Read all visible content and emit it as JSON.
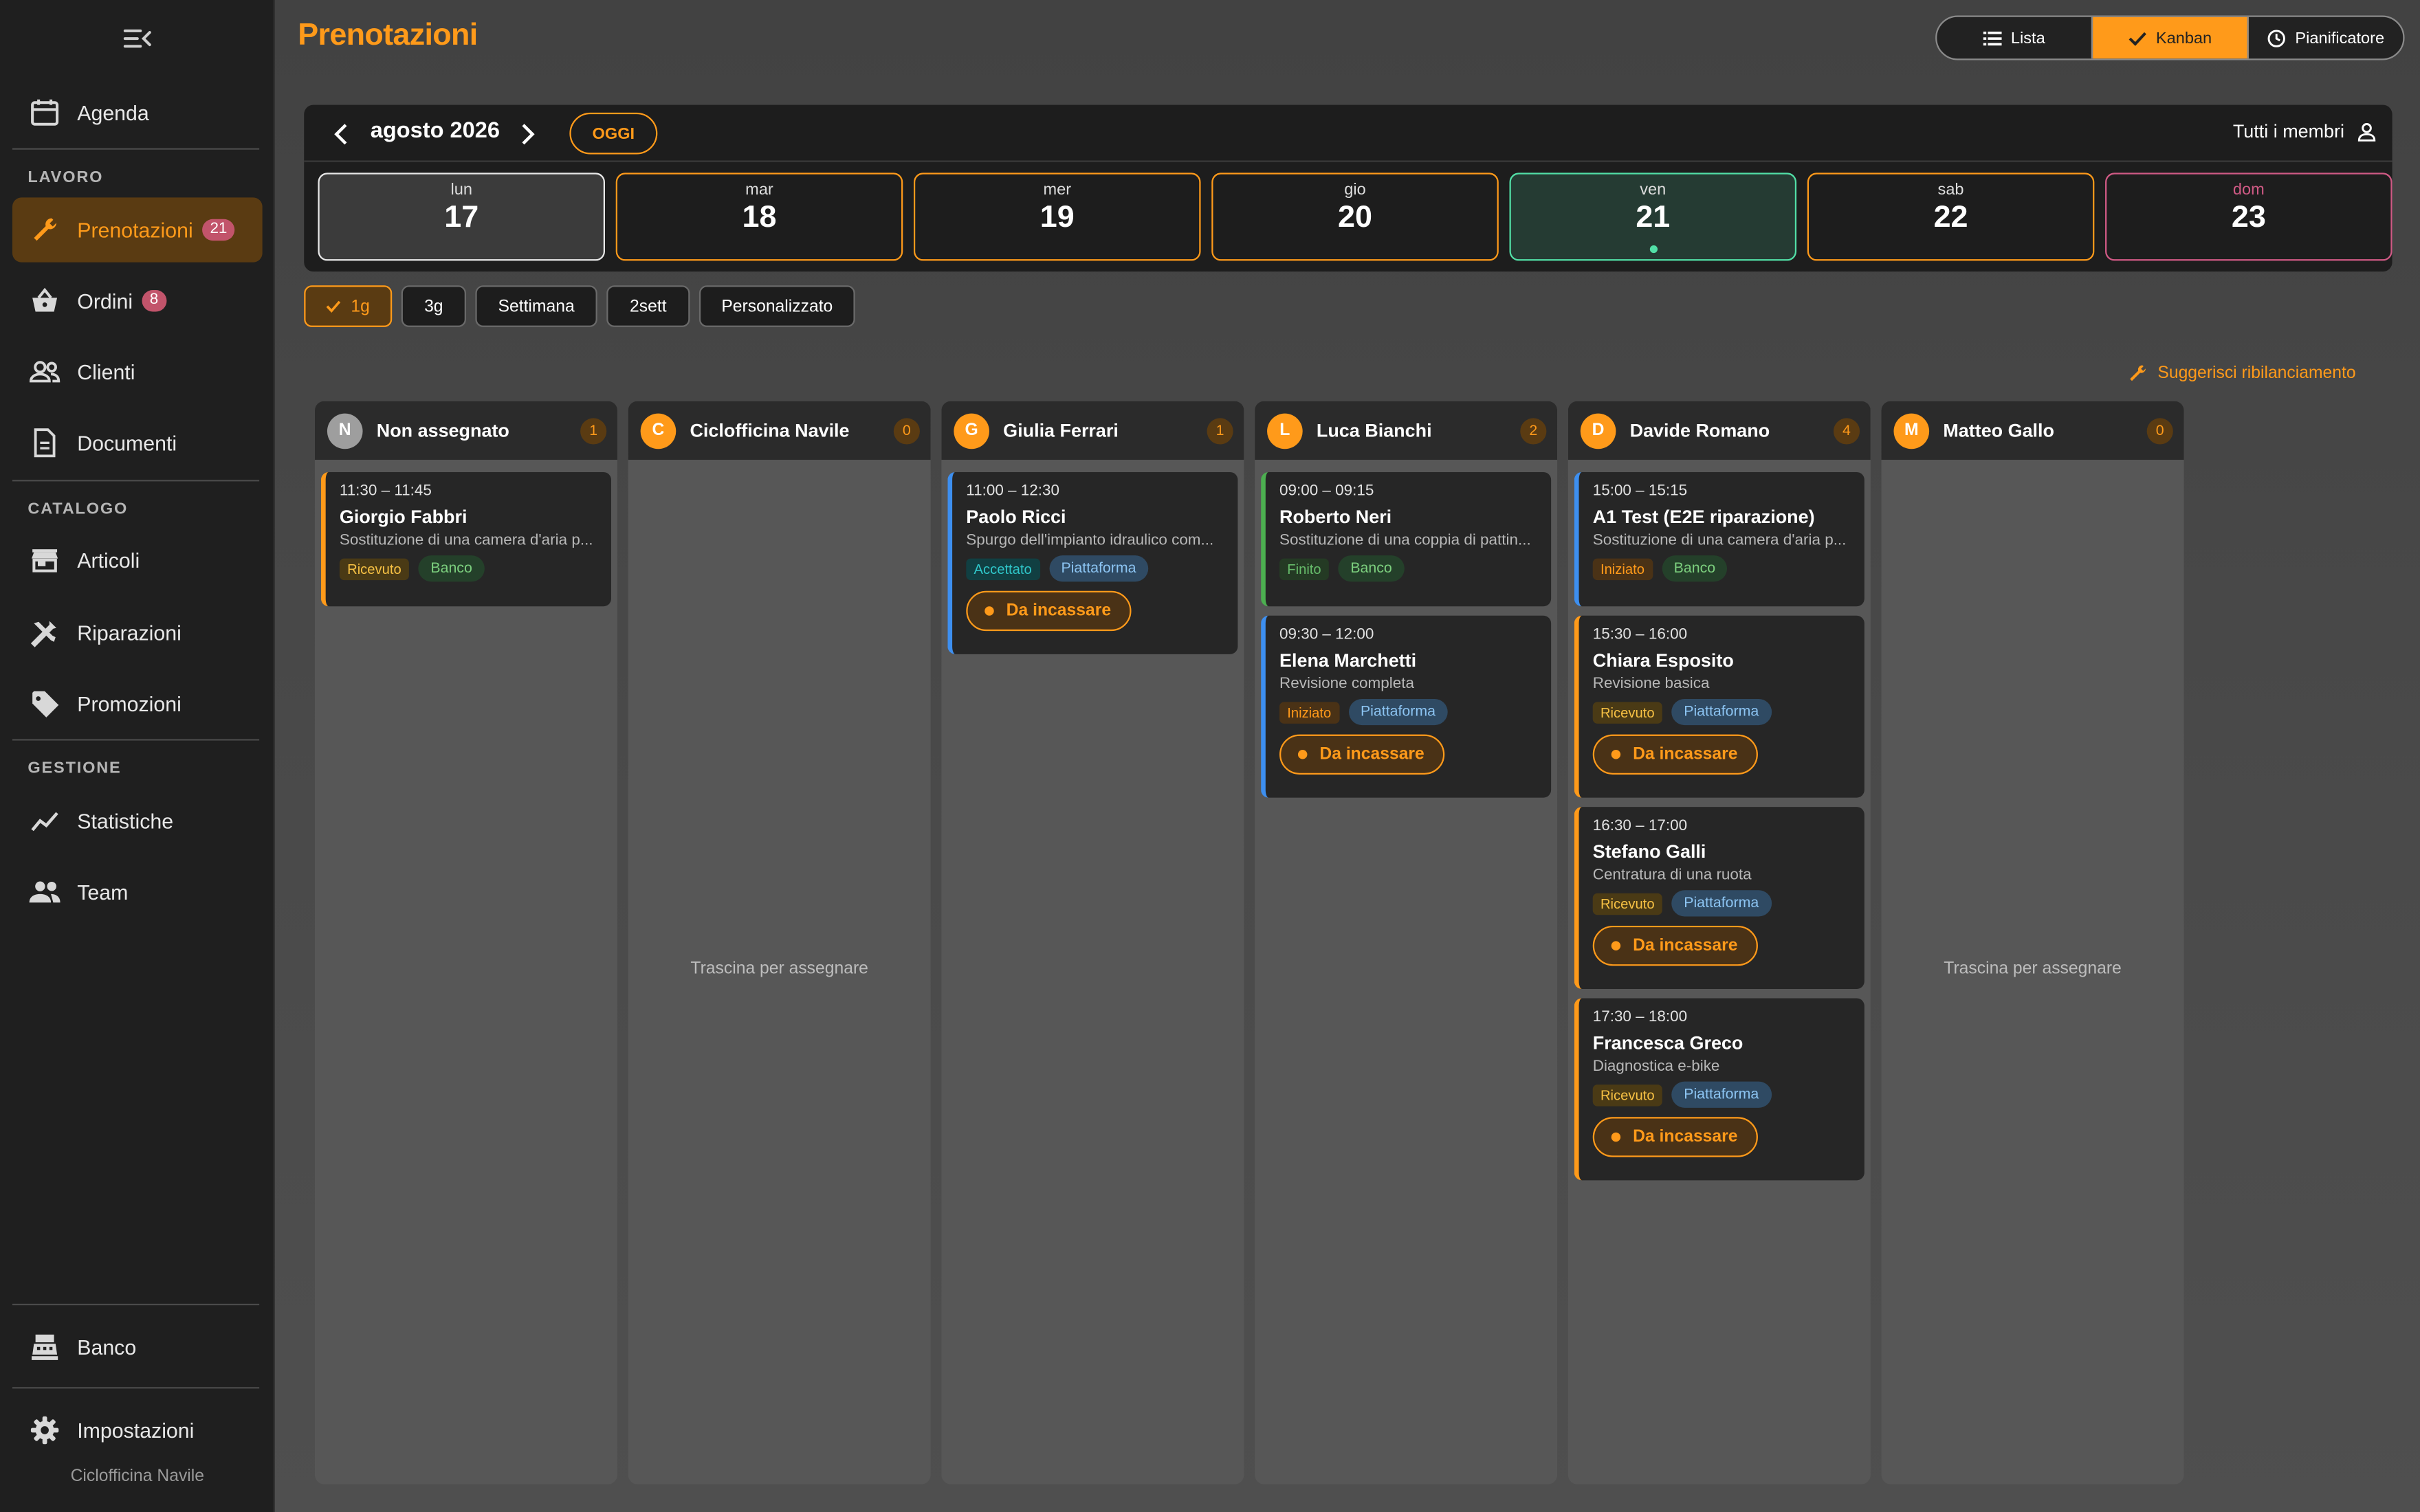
{
  "sidebar": {
    "top_item": {
      "label": "Agenda",
      "icon": "calendar-icon"
    },
    "sections": {
      "lavoro": "LAVORO",
      "catalogo": "CATALOGO",
      "gestione": "GESTIONE"
    },
    "items": {
      "prenotazioni": {
        "label": "Prenotazioni",
        "badge": "21",
        "icon": "wrench-icon"
      },
      "ordini": {
        "label": "Ordini",
        "badge": "8",
        "icon": "basket-icon"
      },
      "clienti": {
        "label": "Clienti",
        "icon": "people-icon"
      },
      "documenti": {
        "label": "Documenti",
        "icon": "document-icon"
      },
      "articoli": {
        "label": "Articoli",
        "icon": "store-icon"
      },
      "riparazioni": {
        "label": "Riparazioni",
        "icon": "tools-icon"
      },
      "promozioni": {
        "label": "Promozioni",
        "icon": "tag-icon"
      },
      "statistiche": {
        "label": "Statistiche",
        "icon": "chart-line-icon"
      },
      "team": {
        "label": "Team",
        "icon": "team-icon"
      },
      "banco": {
        "label": "Banco",
        "icon": "register-icon"
      },
      "impostazioni": {
        "label": "Impostazioni",
        "icon": "gear-icon"
      }
    },
    "shop_name": "Ciclofficina Navile"
  },
  "header": {
    "title": "Prenotazioni",
    "views": [
      "Lista",
      "Kanban",
      "Pianificatore"
    ],
    "selected_view": "Kanban"
  },
  "datebar": {
    "month": "agosto 2026",
    "today_label": "OGGI",
    "members": "Tutti i membri",
    "days": [
      {
        "name": "lun",
        "num": "17"
      },
      {
        "name": "mar",
        "num": "18"
      },
      {
        "name": "mer",
        "num": "19"
      },
      {
        "name": "gio",
        "num": "20"
      },
      {
        "name": "ven",
        "num": "21"
      },
      {
        "name": "sab",
        "num": "22"
      },
      {
        "name": "dom",
        "num": "23"
      }
    ]
  },
  "ranges": [
    "1g",
    "3g",
    "Settimana",
    "2sett",
    "Personalizzato"
  ],
  "suggest": "Suggerisci ribilanciamento",
  "drop_hint": "Trascina per assegnare",
  "colors": {
    "accent": "#ff9a1a",
    "today": "#52e0a7",
    "sunday": "#d05a85",
    "blue": "#3d8ff0",
    "green": "#4caf50"
  },
  "columns": [
    {
      "initial": "N",
      "name": "Non assegnato",
      "count": "1",
      "cards": [
        {
          "time": "11:30 – 11:45",
          "name": "Giorgio Fabbri",
          "desc": "Sostituzione di una camera d'aria p...",
          "status": "Ricevuto",
          "channel": "Banco"
        }
      ]
    },
    {
      "initial": "C",
      "name": "Ciclofficina Navile",
      "count": "0",
      "cards": []
    },
    {
      "initial": "G",
      "name": "Giulia Ferrari",
      "count": "1",
      "cards": [
        {
          "time": "11:00 – 12:30",
          "name": "Paolo Ricci",
          "desc": "Spurgo dell'impianto idraulico com...",
          "status": "Accettato",
          "channel": "Piattaforma",
          "payment": "Da incassare"
        }
      ]
    },
    {
      "initial": "L",
      "name": "Luca Bianchi",
      "count": "2",
      "cards": [
        {
          "time": "09:00 – 09:15",
          "name": "Roberto Neri",
          "desc": "Sostituzione di una coppia di pattin...",
          "status": "Finito",
          "channel": "Banco"
        },
        {
          "time": "09:30 – 12:00",
          "name": "Elena Marchetti",
          "desc": "Revisione completa",
          "status": "Iniziato",
          "channel": "Piattaforma",
          "payment": "Da incassare"
        }
      ]
    },
    {
      "initial": "D",
      "name": "Davide Romano",
      "count": "4",
      "cards": [
        {
          "time": "15:00 – 15:15",
          "name": "A1 Test (E2E riparazione)",
          "desc": "Sostituzione di una camera d'aria p...",
          "status": "Iniziato",
          "channel": "Banco"
        },
        {
          "time": "15:30 – 16:00",
          "name": "Chiara Esposito",
          "desc": "Revisione basica",
          "status": "Ricevuto",
          "channel": "Piattaforma",
          "payment": "Da incassare"
        },
        {
          "time": "16:30 – 17:00",
          "name": "Stefano Galli",
          "desc": "Centratura di una ruota",
          "status": "Ricevuto",
          "channel": "Piattaforma",
          "payment": "Da incassare"
        },
        {
          "time": "17:30 – 18:00",
          "name": "Francesca Greco",
          "desc": "Diagnostica e-bike",
          "status": "Ricevuto",
          "channel": "Piattaforma",
          "payment": "Da incassare"
        }
      ]
    },
    {
      "initial": "M",
      "name": "Matteo Gallo",
      "count": "0",
      "cards": []
    }
  ]
}
